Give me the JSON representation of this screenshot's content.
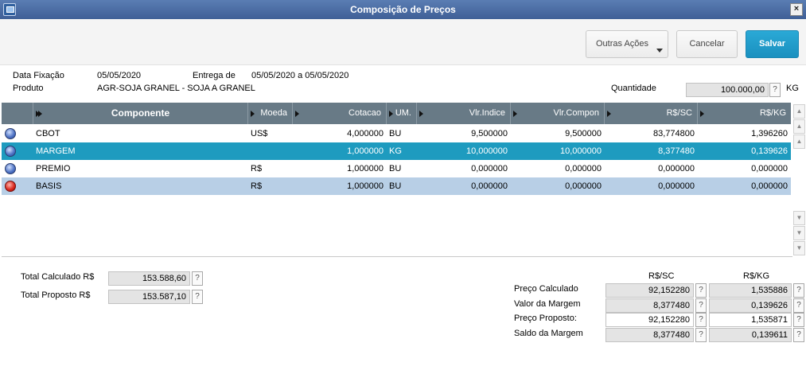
{
  "window": {
    "title": "Composição de Preços",
    "close": "×"
  },
  "toolbar": {
    "outras": "Outras Ações",
    "cancelar": "Cancelar",
    "salvar": "Salvar"
  },
  "header": {
    "data_fixacao_label": "Data Fixação",
    "data_fixacao": "05/05/2020",
    "entrega_label": "Entrega de",
    "entrega": "05/05/2020 a 05/05/2020",
    "produto_label": "Produto",
    "produto": "AGR-SOJA GRANEL - SOJA A GRANEL",
    "quantidade_label": "Quantidade",
    "quantidade": "100.000,00",
    "unidade": "KG",
    "help": "?"
  },
  "grid": {
    "columns": [
      "Componente",
      "Moeda",
      "Cotacao",
      "UM.",
      "Vlr.Indice",
      "Vlr.Compon",
      "R$/SC",
      "R$/KG"
    ],
    "rows": [
      {
        "status": "blue",
        "componente": "CBOT",
        "moeda": "US$",
        "cotacao": "4,000000",
        "um": "BU",
        "vlr_indice": "9,500000",
        "vlr_compon": "9,500000",
        "rs_sc": "83,774800",
        "rs_kg": "1,396260"
      },
      {
        "status": "blue",
        "componente": "MARGEM",
        "moeda": "",
        "cotacao": "1,000000",
        "um": "KG",
        "vlr_indice": "10,000000",
        "vlr_compon": "10,000000",
        "rs_sc": "8,377480",
        "rs_kg": "0,139626"
      },
      {
        "status": "blue",
        "componente": "PREMIO",
        "moeda": "R$",
        "cotacao": "1,000000",
        "um": "BU",
        "vlr_indice": "0,000000",
        "vlr_compon": "0,000000",
        "rs_sc": "0,000000",
        "rs_kg": "0,000000"
      },
      {
        "status": "red",
        "componente": "BASIS",
        "moeda": "R$",
        "cotacao": "1,000000",
        "um": "BU",
        "vlr_indice": "0,000000",
        "vlr_compon": "0,000000",
        "rs_sc": "0,000000",
        "rs_kg": "0,000000"
      }
    ],
    "colors": {
      "header": "#687a86",
      "selected": "#1e9bbf",
      "alt": "#b8cfe6"
    }
  },
  "totals": {
    "calc_label": "Total Calculado R$",
    "calc": "153.588,60",
    "prop_label": "Total Proposto R$",
    "prop": "153.587,10"
  },
  "summary": {
    "col_sc": "R$/SC",
    "col_kg": "R$/KG",
    "rows": [
      {
        "label": "Preço Calculado",
        "sc": "92,152280",
        "kg": "1,535886"
      },
      {
        "label": "Valor da Margem",
        "sc": "8,377480",
        "kg": "0,139626"
      },
      {
        "label": "Preço Proposto:",
        "sc": "92,152280",
        "kg": "1,535871"
      },
      {
        "label": "Saldo da Margem",
        "sc": "8,377480",
        "kg": "0,139611"
      }
    ]
  }
}
